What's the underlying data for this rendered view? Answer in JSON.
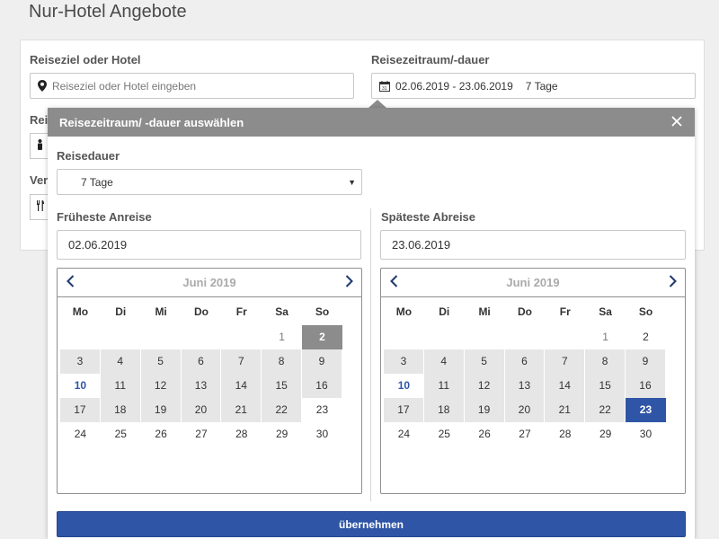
{
  "page": {
    "title": "Nur-Hotel Angebote"
  },
  "search": {
    "destination_label": "Reiseziel oder Hotel",
    "destination_placeholder": "Reiseziel oder Hotel eingeben",
    "period_label": "Reisezeitraum/-dauer",
    "period_value": "02.06.2019 - 23.06.2019",
    "period_duration": "7 Tage",
    "row2_label_partial": "Rei",
    "row3_label_partial": "Ver"
  },
  "modal": {
    "title": "Reisezeitraum/ -dauer auswählen",
    "duration_label": "Reisedauer",
    "duration_value": "7 Tage",
    "earliest_label": "Früheste Anreise",
    "earliest_value": "02.06.2019",
    "latest_label": "Späteste Abreise",
    "latest_value": "23.06.2019",
    "apply_label": "übernehmen"
  },
  "weekdays": [
    "Mo",
    "Di",
    "Mi",
    "Do",
    "Fr",
    "Sa",
    "So"
  ],
  "calendars": [
    {
      "month_title": "Juni 2019",
      "weeks": [
        [
          null,
          null,
          null,
          null,
          null,
          {
            "d": "1",
            "s": "muted"
          },
          {
            "d": "2",
            "s": "sel"
          }
        ],
        [
          {
            "d": "3",
            "s": "avail"
          },
          {
            "d": "4",
            "s": "avail"
          },
          {
            "d": "5",
            "s": "avail"
          },
          {
            "d": "6",
            "s": "avail"
          },
          {
            "d": "7",
            "s": "avail"
          },
          {
            "d": "8",
            "s": "avail"
          },
          {
            "d": "9",
            "s": "avail"
          }
        ],
        [
          {
            "d": "10",
            "s": "today"
          },
          {
            "d": "11",
            "s": "avail"
          },
          {
            "d": "12",
            "s": "avail"
          },
          {
            "d": "13",
            "s": "avail"
          },
          {
            "d": "14",
            "s": "avail"
          },
          {
            "d": "15",
            "s": "avail"
          },
          {
            "d": "16",
            "s": "avail"
          }
        ],
        [
          {
            "d": "17",
            "s": "avail"
          },
          {
            "d": "18",
            "s": "avail"
          },
          {
            "d": "19",
            "s": "avail"
          },
          {
            "d": "20",
            "s": "avail"
          },
          {
            "d": "21",
            "s": "avail"
          },
          {
            "d": "22",
            "s": "avail"
          },
          {
            "d": "23",
            "s": ""
          }
        ],
        [
          {
            "d": "24",
            "s": ""
          },
          {
            "d": "25",
            "s": ""
          },
          {
            "d": "26",
            "s": ""
          },
          {
            "d": "27",
            "s": ""
          },
          {
            "d": "28",
            "s": ""
          },
          {
            "d": "29",
            "s": ""
          },
          {
            "d": "30",
            "s": ""
          }
        ]
      ]
    },
    {
      "month_title": "Juni 2019",
      "weeks": [
        [
          null,
          null,
          null,
          null,
          null,
          {
            "d": "1",
            "s": "muted"
          },
          {
            "d": "2",
            "s": ""
          }
        ],
        [
          {
            "d": "3",
            "s": "avail"
          },
          {
            "d": "4",
            "s": "avail"
          },
          {
            "d": "5",
            "s": "avail"
          },
          {
            "d": "6",
            "s": "avail"
          },
          {
            "d": "7",
            "s": "avail"
          },
          {
            "d": "8",
            "s": "avail"
          },
          {
            "d": "9",
            "s": "avail"
          }
        ],
        [
          {
            "d": "10",
            "s": "today"
          },
          {
            "d": "11",
            "s": "avail"
          },
          {
            "d": "12",
            "s": "avail"
          },
          {
            "d": "13",
            "s": "avail"
          },
          {
            "d": "14",
            "s": "avail"
          },
          {
            "d": "15",
            "s": "avail"
          },
          {
            "d": "16",
            "s": "avail"
          }
        ],
        [
          {
            "d": "17",
            "s": "avail"
          },
          {
            "d": "18",
            "s": "avail"
          },
          {
            "d": "19",
            "s": "avail"
          },
          {
            "d": "20",
            "s": "avail"
          },
          {
            "d": "21",
            "s": "avail"
          },
          {
            "d": "22",
            "s": "avail"
          },
          {
            "d": "23",
            "s": "sel-blue"
          }
        ],
        [
          {
            "d": "24",
            "s": ""
          },
          {
            "d": "25",
            "s": ""
          },
          {
            "d": "26",
            "s": ""
          },
          {
            "d": "27",
            "s": ""
          },
          {
            "d": "28",
            "s": ""
          },
          {
            "d": "29",
            "s": ""
          },
          {
            "d": "30",
            "s": ""
          }
        ]
      ]
    }
  ],
  "colors": {
    "accent": "#2f55a6",
    "header_gray": "#8c8c8c",
    "available_day": "#e6e6e6"
  }
}
